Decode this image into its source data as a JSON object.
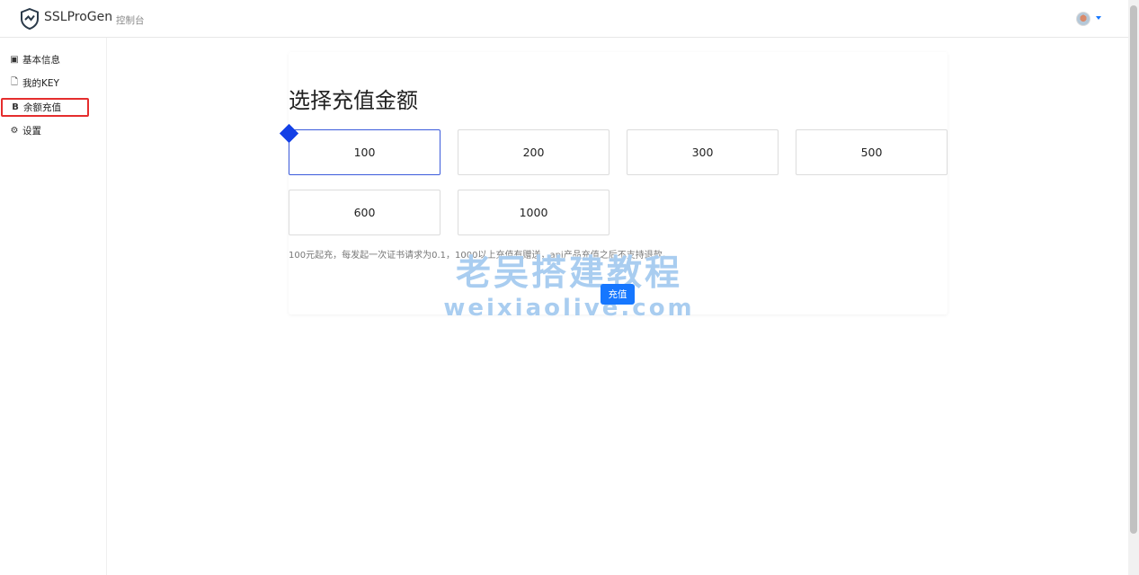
{
  "header": {
    "brand": "SSLProGen",
    "nav_console": "控制台"
  },
  "sidebar": {
    "items": [
      {
        "label": "基本信息",
        "icon": "id-card-icon",
        "glyph": "▣"
      },
      {
        "label": "我的KEY",
        "icon": "file-icon",
        "glyph": "🗋"
      },
      {
        "label": "余额充值",
        "icon": "bitcoin-icon",
        "glyph": "B"
      },
      {
        "label": "设置",
        "icon": "gear-icon",
        "glyph": "⚙"
      }
    ],
    "active_index": 2
  },
  "main": {
    "title": "选择充值金额",
    "amounts": [
      "100",
      "200",
      "300",
      "500",
      "600",
      "1000"
    ],
    "selected_amount": "100",
    "note": "100元起充，每发起一次证书请求为0.1，1000以上充值有赠送，api产品充值之后不支持退款。",
    "pay_button": "充值"
  },
  "watermark": {
    "line1": "老吴搭建教程",
    "line2": "weixiaolive.com"
  },
  "colors": {
    "accent": "#1677ff",
    "selected_border": "#3b5bdb",
    "active_outline": "#e52d2d"
  }
}
